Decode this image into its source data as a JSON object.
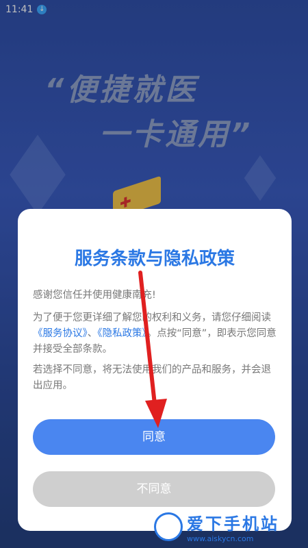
{
  "status_bar": {
    "time": "11:41",
    "download_icon": "arrow-down-circle-icon"
  },
  "background": {
    "slogan_line1": "“便捷就医",
    "slogan_line2": "一卡通用”"
  },
  "dialog": {
    "title": "服务条款与隐私政策",
    "paragraph1": "感谢您信任并使用健康南充!",
    "paragraph2_before": "为了便于您更详细了解您的权利和义务，请您仔细阅读",
    "service_agreement_link": "《服务协议》",
    "separator": "、",
    "privacy_policy_link": "《隐私政策》",
    "paragraph2_after": "。点按“同意”，即表示您同意并接受全部条款。",
    "paragraph3": "若选择不同意，将无法使用我们的产品和服务，并会退出应用。",
    "agree_label": "同意",
    "disagree_label": "不同意"
  },
  "watermark": {
    "title": "爱下手机站",
    "url": "www.aiskycn.com"
  },
  "colors": {
    "accent": "#2b78e4",
    "button_agree": "#4a86f0",
    "button_disagree": "#cfcfcf",
    "arrow": "#e02020"
  }
}
